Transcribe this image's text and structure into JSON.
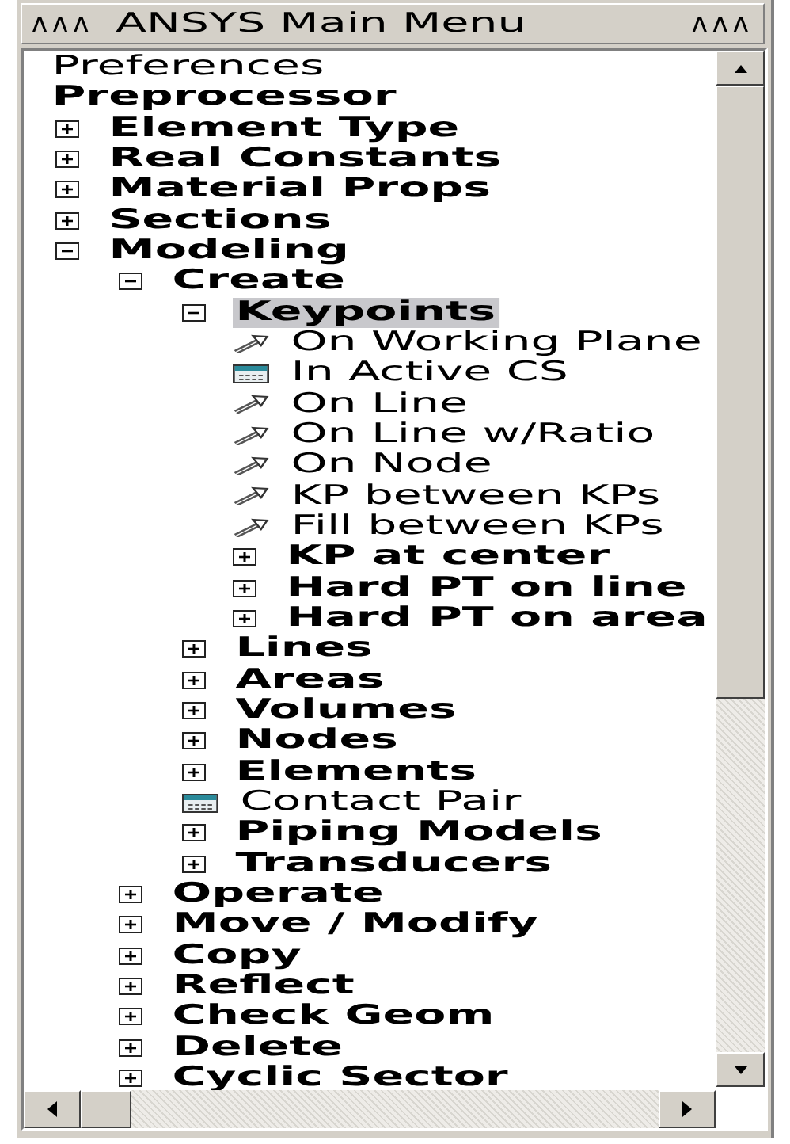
{
  "title_bar": {
    "left_button": "ᴧᴧᴧ",
    "title": "ANSYS Main Menu",
    "right_button": "ᴧᴧᴧ"
  },
  "tree": [
    {
      "label": "Preferences",
      "kind": "link",
      "selected": false
    },
    {
      "label": "Preprocessor",
      "kind": "root",
      "selected": false,
      "children": [
        {
          "label": "Element Type",
          "kind": "folder",
          "expanded": false,
          "selected": false
        },
        {
          "label": "Real Constants",
          "kind": "folder",
          "expanded": false,
          "selected": false
        },
        {
          "label": "Material Props",
          "kind": "folder",
          "expanded": false,
          "selected": false
        },
        {
          "label": "Sections",
          "kind": "folder",
          "expanded": false,
          "selected": false
        },
        {
          "label": "Modeling",
          "kind": "folder",
          "expanded": true,
          "selected": false,
          "children": [
            {
              "label": "Create",
              "kind": "folder",
              "expanded": true,
              "selected": false,
              "children": [
                {
                  "label": "Keypoints",
                  "kind": "folder",
                  "expanded": true,
                  "selected": true,
                  "children": [
                    {
                      "label": "On Working Plane",
                      "kind": "action",
                      "selected": false
                    },
                    {
                      "label": "In Active CS",
                      "kind": "dialog",
                      "selected": false
                    },
                    {
                      "label": "On Line",
                      "kind": "action",
                      "selected": false
                    },
                    {
                      "label": "On Line w/Ratio",
                      "kind": "action",
                      "selected": false
                    },
                    {
                      "label": "On Node",
                      "kind": "action",
                      "selected": false
                    },
                    {
                      "label": "KP between KPs",
                      "kind": "action",
                      "selected": false
                    },
                    {
                      "label": "Fill between KPs",
                      "kind": "action",
                      "selected": false
                    },
                    {
                      "label": "KP at center",
                      "kind": "folder",
                      "expanded": false,
                      "selected": false
                    },
                    {
                      "label": "Hard PT on line",
                      "kind": "folder",
                      "expanded": false,
                      "selected": false
                    },
                    {
                      "label": "Hard PT on area",
                      "kind": "folder",
                      "expanded": false,
                      "selected": false
                    }
                  ]
                },
                {
                  "label": "Lines",
                  "kind": "folder",
                  "expanded": false,
                  "selected": false
                },
                {
                  "label": "Areas",
                  "kind": "folder",
                  "expanded": false,
                  "selected": false
                },
                {
                  "label": "Volumes",
                  "kind": "folder",
                  "expanded": false,
                  "selected": false
                },
                {
                  "label": "Nodes",
                  "kind": "folder",
                  "expanded": false,
                  "selected": false
                },
                {
                  "label": "Elements",
                  "kind": "folder",
                  "expanded": false,
                  "selected": false
                },
                {
                  "label": "Contact Pair",
                  "kind": "dialog",
                  "selected": false
                },
                {
                  "label": "Piping Models",
                  "kind": "folder",
                  "expanded": false,
                  "selected": false
                },
                {
                  "label": "Transducers",
                  "kind": "folder",
                  "expanded": false,
                  "selected": false
                }
              ]
            },
            {
              "label": "Operate",
              "kind": "folder",
              "expanded": false,
              "selected": false
            },
            {
              "label": "Move / Modify",
              "kind": "folder",
              "expanded": false,
              "selected": false
            },
            {
              "label": "Copy",
              "kind": "folder",
              "expanded": false,
              "selected": false
            },
            {
              "label": "Reflect",
              "kind": "folder",
              "expanded": false,
              "selected": false
            },
            {
              "label": "Check Geom",
              "kind": "folder",
              "expanded": false,
              "selected": false
            },
            {
              "label": "Delete",
              "kind": "folder",
              "expanded": false,
              "selected": false
            },
            {
              "label": "Cyclic Sector",
              "kind": "folder",
              "expanded": false,
              "selected": false
            }
          ]
        }
      ]
    }
  ]
}
